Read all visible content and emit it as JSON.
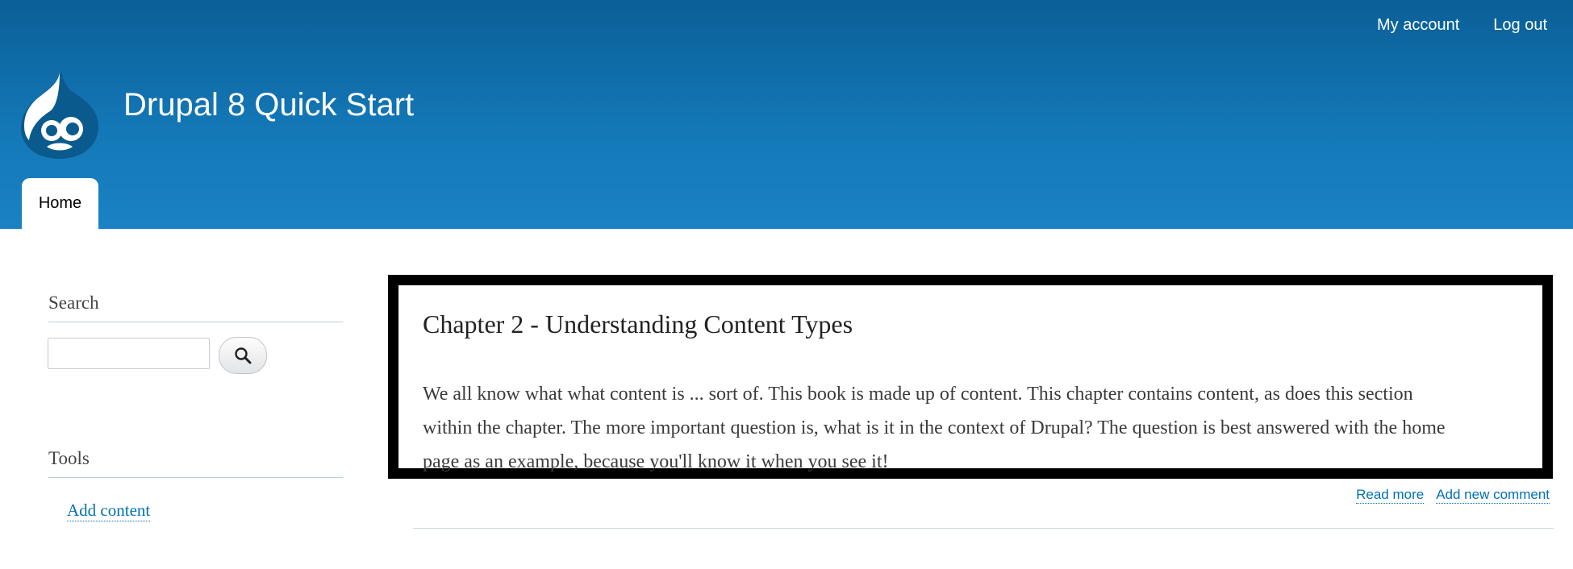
{
  "header": {
    "site_name": "Drupal 8 Quick Start",
    "logo_icon": "drupal-drop-icon",
    "user_menu": {
      "my_account": "My account",
      "log_out": "Log out"
    },
    "main_menu": {
      "home": "Home"
    }
  },
  "sidebar": {
    "search": {
      "title": "Search",
      "input_value": "",
      "button_icon": "search-icon"
    },
    "tools": {
      "title": "Tools",
      "add_content": "Add content"
    }
  },
  "article": {
    "title": "Chapter 2 - Understanding Content Types",
    "body_lines": [
      "We all know what what content is ... sort of. This book is made up of content. This chapter contains content, as does this section",
      "within the chapter. The more important question is, what is it in the context of Drupal? The question is best answered with the home",
      "page as an example, because you'll know it when you see it!"
    ],
    "links": {
      "read_more": "Read more",
      "add_comment": "Add new comment"
    }
  },
  "colors": {
    "header_top": "#0b5f97",
    "header_bottom": "#1a82c3",
    "link": "#0071b3",
    "article_border": "#000000"
  }
}
